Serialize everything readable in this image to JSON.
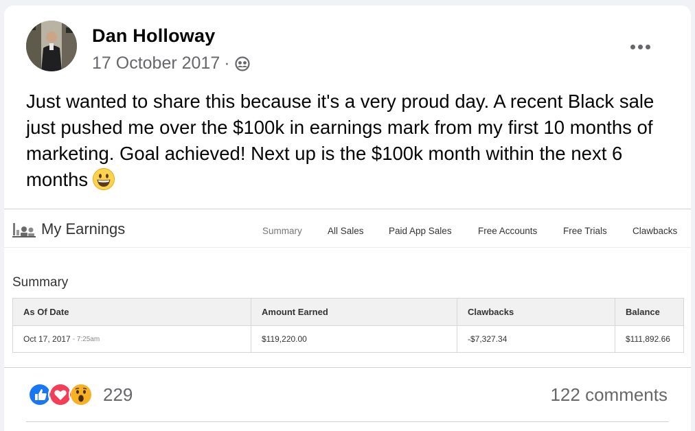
{
  "post": {
    "author": "Dan Holloway",
    "date": "17 October 2017",
    "separator": "·",
    "audience_icon": "friends-icon",
    "text": "Just wanted to share this because it's a very proud day. A recent Black sale just pushed me over the $100k in earnings mark from my first 10 months of marketing. Goal achieved! Next up is the $100k month within the next 6 months",
    "emoji_icon": "grinning-face-icon"
  },
  "screenshot": {
    "title": "My Earnings",
    "tabs": [
      "Summary",
      "All Sales",
      "Paid App Sales",
      "Free Accounts",
      "Free Trials",
      "Clawbacks"
    ],
    "active_tab": "Summary",
    "section_heading": "Summary",
    "table": {
      "headers": [
        "As Of Date",
        "Amount Earned",
        "Clawbacks",
        "Balance"
      ],
      "row": {
        "date": "Oct 17, 2017",
        "time": "- 7:25am",
        "amount_earned": "$119,220.00",
        "clawbacks": "-$7,327.34",
        "balance": "$111,892.66"
      }
    }
  },
  "footer": {
    "reaction_icons": [
      "like-icon",
      "love-icon",
      "wow-icon"
    ],
    "reaction_count": "229",
    "comments": "122 comments"
  },
  "colors": {
    "like": "#1877f2",
    "love": "#f33e58",
    "wow": "#f7b125",
    "negative": "#e0241c",
    "muted_text": "#65676b"
  }
}
